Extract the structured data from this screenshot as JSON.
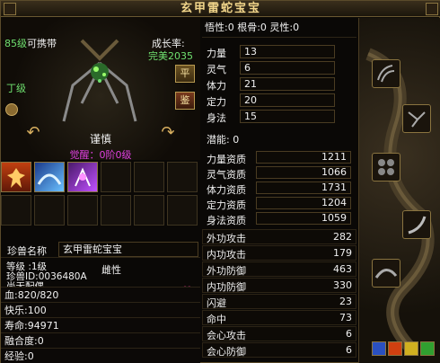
{
  "window": {
    "title": "玄甲雷蛇宝宝"
  },
  "pet": {
    "level_num": "85级",
    "level_txt": "可携带",
    "growth_label": "成长率:",
    "growth_value": "完美2035",
    "grade": "丁级",
    "name": "谨慎",
    "awaken": "觉醒：0阶0级",
    "btn_ping": "平",
    "btn_jian": "鉴"
  },
  "name_field": {
    "label": "珍兽名称",
    "value": "玄甲雷蛇宝宝"
  },
  "info": {
    "level": "等级 :1级",
    "gender": "雌性",
    "pet_id": "珍兽ID:0036480A",
    "mate": "尚无配偶"
  },
  "left_stats": [
    "血:820/820",
    "快乐:100",
    "寿命:94971",
    "融合度:0",
    "经验:0"
  ],
  "top": "悟性:0  根骨:0  灵性:0",
  "attributes": [
    {
      "label": "力量",
      "value": "13"
    },
    {
      "label": "灵气",
      "value": "6"
    },
    {
      "label": "体力",
      "value": "21"
    },
    {
      "label": "定力",
      "value": "20"
    },
    {
      "label": "身法",
      "value": "15"
    }
  ],
  "potential": "潜能:  0",
  "aptitudes": [
    {
      "label": "力量资质",
      "value": "1211"
    },
    {
      "label": "灵气资质",
      "value": "1066"
    },
    {
      "label": "体力资质",
      "value": "1731"
    },
    {
      "label": "定力资质",
      "value": "1204"
    },
    {
      "label": "身法资质",
      "value": "1059"
    }
  ],
  "combat": [
    {
      "label": "外功攻击",
      "value": "282"
    },
    {
      "label": "内功攻击",
      "value": "179"
    },
    {
      "label": "外功防御",
      "value": "463"
    },
    {
      "label": "内功防御",
      "value": "330"
    },
    {
      "label": "闪避",
      "value": "23"
    },
    {
      "label": "命中",
      "value": "73"
    },
    {
      "label": "会心攻击",
      "value": "6"
    },
    {
      "label": "会心防御",
      "value": "6"
    }
  ],
  "icons": {
    "prev": "arrow-left-icon",
    "next": "arrow-right-icon",
    "heart": "heart-icon"
  },
  "colors": {
    "accent": "#f1d58a",
    "green": "#6fe06f",
    "magenta": "#e040e0"
  }
}
